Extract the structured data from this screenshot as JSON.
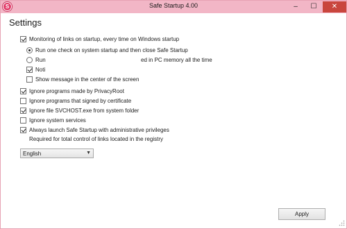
{
  "window": {
    "title": "Safe Startup 4.00",
    "app_icon_letter": "S",
    "controls": {
      "minimize": "–",
      "maximize": "☐",
      "close": "✕"
    }
  },
  "settings": {
    "heading": "Settings",
    "monitoring": {
      "label": "Monitoring of links on startup, every time on Windows startup",
      "checked": true
    },
    "mode_options": [
      {
        "label": "Run one check on system startup and then close Safe Startup",
        "selected": true
      },
      {
        "label": "Run",
        "selected": false
      }
    ],
    "run_mode_trailing_text": "ed in PC memory all the time",
    "notify": {
      "label": "Noti",
      "checked": true
    },
    "show_center": {
      "label": "Show message in the center of the screen",
      "checked": false
    },
    "ignore_privacyroot": {
      "label": "Ignore programs made by PrivacyRoot",
      "checked": true
    },
    "ignore_signed": {
      "label": "Ignore programs that signed by certificate",
      "checked": false
    },
    "ignore_svchost": {
      "label": "Ignore file SVCHOST.exe from system folder",
      "checked": true
    },
    "ignore_services": {
      "label": "Ignore system services",
      "checked": false
    },
    "admin_launch": {
      "label": "Always launch Safe Startup with administrative privileges",
      "checked": true
    },
    "admin_note": "Required for total control of links located in the registry",
    "language": {
      "selected": "English"
    },
    "apply_label": "Apply"
  }
}
